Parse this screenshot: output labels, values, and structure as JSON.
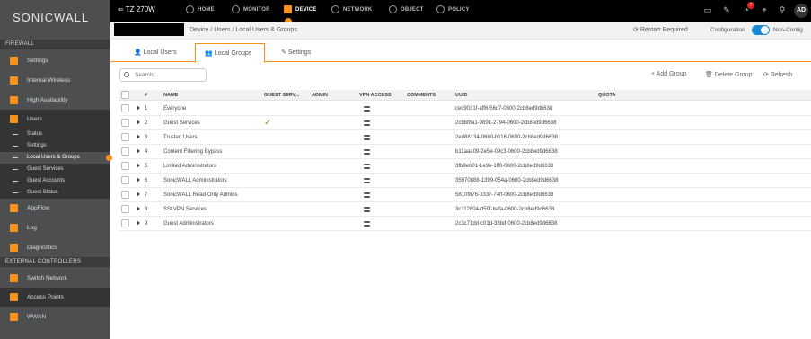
{
  "brand": {
    "logo": "SONICWALL",
    "model": "TZ 270W"
  },
  "nav": [
    {
      "label": "HOME",
      "icon": "gauge-icon"
    },
    {
      "label": "MONITOR",
      "icon": "chart-icon"
    },
    {
      "label": "DEVICE",
      "icon": "device-icon",
      "active": true
    },
    {
      "label": "NETWORK",
      "icon": "network-icon"
    },
    {
      "label": "OBJECT",
      "icon": "object-icon"
    },
    {
      "label": "POLICY",
      "icon": "policy-icon"
    }
  ],
  "top_right": {
    "notification_count": "7",
    "avatar": "AD"
  },
  "sidebar": {
    "sections": [
      "FIREWALL",
      "EXTERNAL CONTROLLERS"
    ],
    "items": [
      "Settings",
      "Internal Wireless",
      "High Availability",
      "Users",
      "AppFlow",
      "Log",
      "Diagnostics",
      "Switch Network",
      "Access Points",
      "WWAN"
    ],
    "sub_items": [
      "Status",
      "Settings",
      "Local Users & Groups",
      "Guest Services",
      "Guest Accounts",
      "Guest Status"
    ]
  },
  "breadcrumb": "Device  /  Users  /  Local Users & Groups",
  "header_right": {
    "restart": "Restart Required",
    "configuration": "Configuration",
    "non_config": "Non-Config"
  },
  "tabs": [
    "Local Users",
    "Local Groups",
    "Settings"
  ],
  "toolbar": {
    "search_placeholder": "Search...",
    "add": "+ Add Group",
    "delete": "Delete Group",
    "refresh": "Refresh"
  },
  "columns": [
    "#",
    "NAME",
    "GUEST SERV...",
    "ADMIN",
    "VPN ACCESS",
    "COMMENTS",
    "UUID",
    "QUOTA"
  ],
  "rows": [
    {
      "num": "1",
      "name": "Everyone",
      "guest": "",
      "uuid": "cec9031f-aff6-56c7-0600-2cb8ed9d6638"
    },
    {
      "num": "2",
      "name": "Guest Services",
      "guest": "✓",
      "uuid": "2cbbf8a1-9891-2794-0600-2cb8ed9d6638"
    },
    {
      "num": "3",
      "name": "Trusted Users",
      "guest": "",
      "uuid": "2ed88134-06b0-b116-0600-2cb8ed9d6638"
    },
    {
      "num": "4",
      "name": "Content Filtering Bypass",
      "guest": "",
      "uuid": "b11aaa09-2e5e-09c3-0600-2cb8ed9d6638"
    },
    {
      "num": "5",
      "name": "Limited Administrators",
      "guest": "",
      "uuid": "3fb9e601-1e9e-1ff0-0600-2cb8ed9d6638"
    },
    {
      "num": "6",
      "name": "SonicWALL Administrators",
      "guest": "",
      "uuid": "35970888-1399-054a-0600-2cb8ed9d6638"
    },
    {
      "num": "7",
      "name": "SonicWALL Read-Only Admins",
      "guest": "",
      "uuid": "5810f876-0337-74ff-0600-2cb8ed9d6638"
    },
    {
      "num": "8",
      "name": "SSLVPN Services",
      "guest": "",
      "uuid": "3c112804-d59f-bafa-0600-2cb8ed9d6638"
    },
    {
      "num": "9",
      "name": "Guest Administrators",
      "guest": "",
      "uuid": "2c3c71dd-c01d-38bd-0600-2cb8ed9d6638"
    }
  ],
  "colors": {
    "accent": "#f7931d",
    "toggle": "#1a8ad4",
    "check": "#6ab023",
    "notification": "#d9231d"
  }
}
